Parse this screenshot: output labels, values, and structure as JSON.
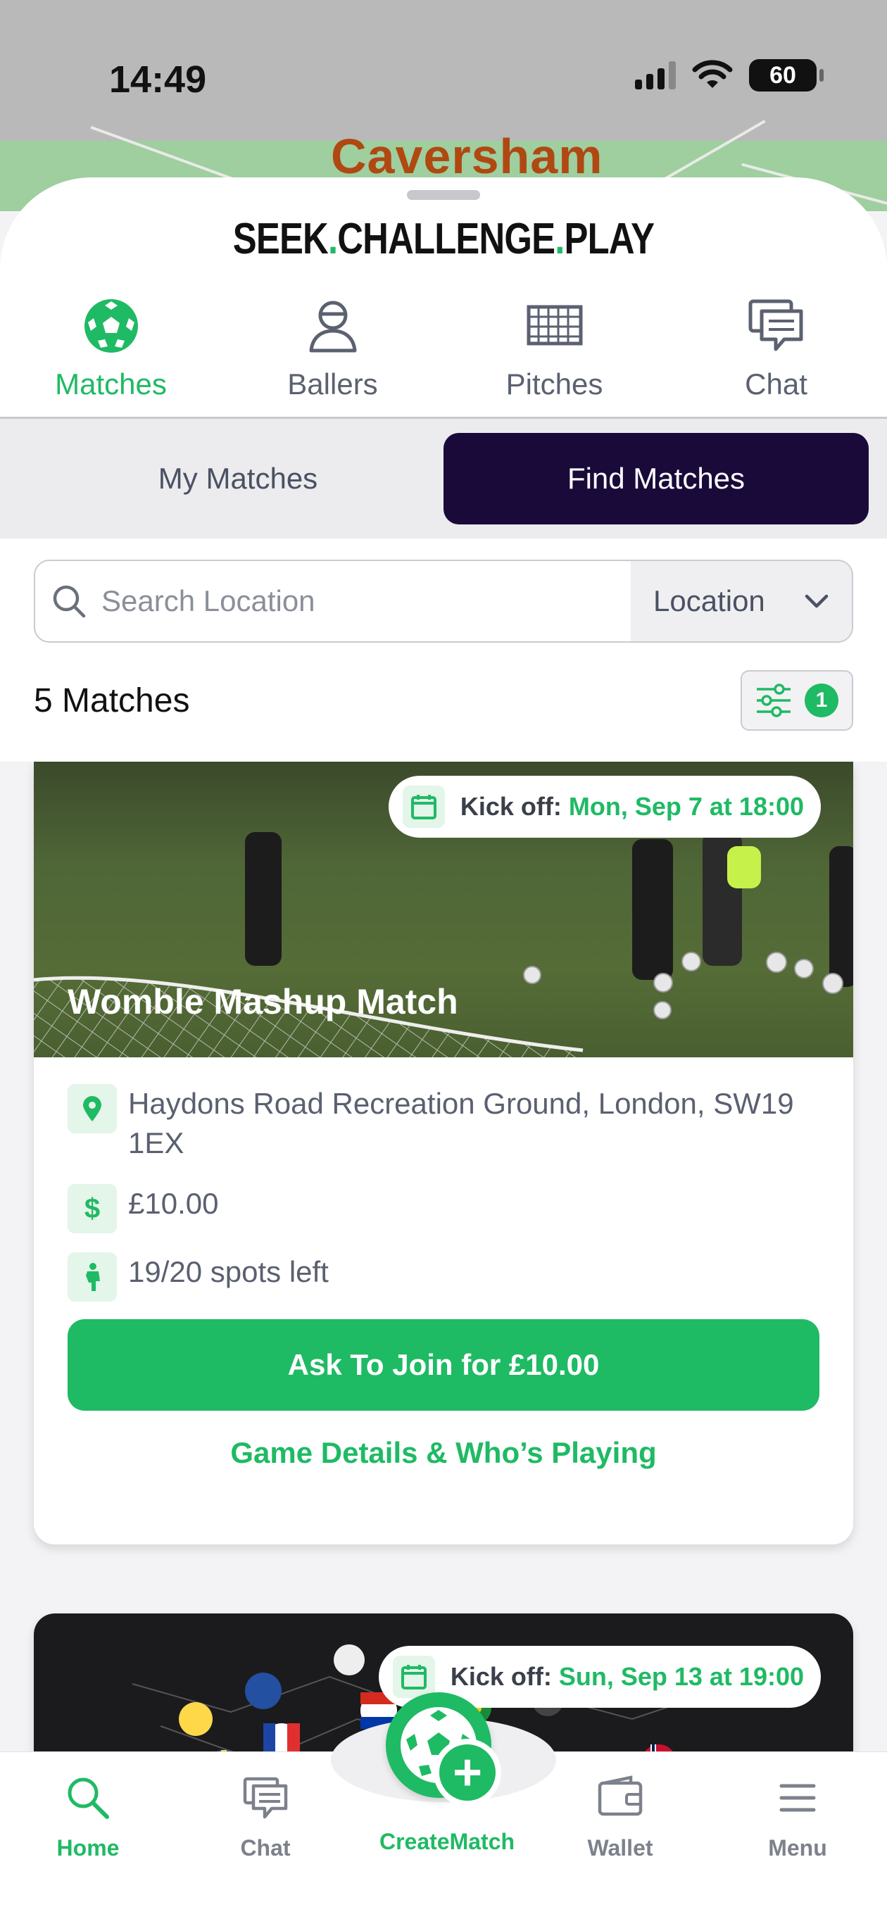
{
  "status": {
    "time": "14:49",
    "battery": "60"
  },
  "map": {
    "label": "Caversham"
  },
  "brand": {
    "part1": "SEEK",
    "part2": "CHALLENGE",
    "part3": "PLAY",
    "sep": "."
  },
  "category_tabs": [
    {
      "label": "Matches",
      "icon": "soccer-ball-icon",
      "active": true
    },
    {
      "label": "Ballers",
      "icon": "person-icon",
      "active": false
    },
    {
      "label": "Pitches",
      "icon": "goal-net-icon",
      "active": false
    },
    {
      "label": "Chat",
      "icon": "chat-bubble-icon",
      "active": false
    }
  ],
  "segments": {
    "my": "My Matches",
    "find": "Find Matches",
    "selected": "Find Matches"
  },
  "search": {
    "placeholder": "Search Location",
    "dropdown_value": "Location"
  },
  "results": {
    "count_label": "5 Matches",
    "filter_count": "1"
  },
  "matches": [
    {
      "title": "Womble Mashup Match",
      "kickoff_prefix": "Kick off:",
      "kickoff_when": "Mon, Sep 7 at 18:00",
      "address": "Haydons Road Recreation Ground, London, SW19 1EX",
      "price": "£10.00",
      "spots": "19/20 spots left",
      "join_label": "Ask To Join for £10.00",
      "details_label": "Game Details & Who’s Playing"
    },
    {
      "kickoff_prefix": "Kick off:",
      "kickoff_when": "Sun, Sep 13 at 19:00"
    }
  ],
  "bottom_nav": [
    {
      "label": "Home",
      "icon": "search-icon",
      "active": true
    },
    {
      "label": "Chat",
      "icon": "chat-icon",
      "active": false
    },
    {
      "label": "CreateMatch",
      "icon": "soccer-ball-plus-icon",
      "active": false
    },
    {
      "label": "Wallet",
      "icon": "wallet-icon",
      "active": false
    },
    {
      "label": "Menu",
      "icon": "hamburger-menu-icon",
      "active": false
    }
  ],
  "colors": {
    "accent": "#1fba64",
    "dark": "#1a0a3a",
    "map_label": "#b04812"
  }
}
